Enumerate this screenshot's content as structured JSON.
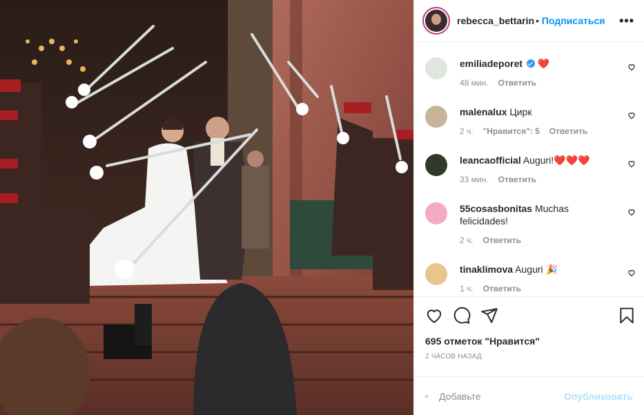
{
  "header": {
    "username": "rebecca_bettarini",
    "separator": "•",
    "follow_label": "Подписаться",
    "more_icon": "more-horizontal-icon"
  },
  "comments": [
    {
      "username": "emiliadeporet",
      "verified": true,
      "text": "❤️",
      "time": "48 мин.",
      "likes_label": "",
      "reply_label": "Ответить",
      "avatar_color": "#dfe6dc"
    },
    {
      "username": "malenalux",
      "text": "Цирк",
      "time": "2 ч.",
      "likes_label": "\"Нравится\": 5",
      "reply_label": "Ответить",
      "avatar_color": "#c8b49c"
    },
    {
      "username": "leancaofficial",
      "text": "Auguri!❤️❤️❤️",
      "time": "33 мин.",
      "likes_label": "",
      "reply_label": "Ответить",
      "avatar_color": "#2f3a2b"
    },
    {
      "username": "55cosasbonitas",
      "text": "Muchas felicidades!",
      "time": "2 ч.",
      "likes_label": "",
      "reply_label": "Ответить",
      "avatar_color": "#f4a9c4"
    },
    {
      "username": "tinaklimova",
      "text": "Auguri 🎉",
      "time": "1 ч.",
      "likes_label": "",
      "reply_label": "Ответить",
      "avatar_color": "#e8c48e"
    }
  ],
  "actions": {
    "like_icon": "heart-outline-icon",
    "comment_icon": "comment-bubble-icon",
    "share_icon": "paper-plane-icon",
    "save_icon": "bookmark-icon"
  },
  "likes_text": "695 отметок \"Нравится\"",
  "posted_time": "2 ЧАСОВ НАЗАД",
  "composer": {
    "emoji_icon": "smiley-icon",
    "placeholder": "Добавьте",
    "publish_label": "Опубликовать"
  },
  "colors": {
    "accent_blue": "#0095f6",
    "publish_disabled": "#b2dffc",
    "muted_text": "#8e8e8e",
    "border": "#efefef"
  }
}
